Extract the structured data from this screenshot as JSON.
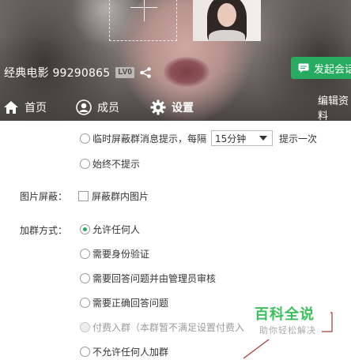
{
  "header": {
    "group_name": "经典电影 99290865",
    "level_badge": "LV0",
    "send_message_button": "发起会话",
    "tabs": [
      {
        "label": "首页",
        "icon": "home-icon"
      },
      {
        "label": "成员",
        "icon": "user-icon"
      },
      {
        "label": "设置",
        "icon": "gear-icon",
        "active": true
      },
      {
        "label": "编辑资料"
      }
    ]
  },
  "settings": {
    "message_notify": {
      "option_periodic_prefix": "临时屏蔽群消息提示，每隔",
      "interval_value": "15分钟",
      "option_periodic_suffix": "提示一次",
      "option_never": "始终不提示"
    },
    "image_block": {
      "label": "图片屏蔽：",
      "checkbox_label": "屏蔽群内图片",
      "checked": false
    },
    "join_method": {
      "label": "加群方式：",
      "options": [
        {
          "label": "允许任何人",
          "selected": true,
          "disabled": false
        },
        {
          "label": "需要身份验证",
          "selected": false,
          "disabled": false
        },
        {
          "label": "需要回答问题并由管理员审核",
          "selected": false,
          "disabled": false
        },
        {
          "label": "需要正确回答问题",
          "selected": false,
          "disabled": false
        },
        {
          "label": "付费入群（本群暂不满足设置付费入",
          "selected": false,
          "disabled": true
        },
        {
          "label": "不允许任何人加群",
          "selected": false,
          "disabled": false
        }
      ]
    }
  },
  "watermark": {
    "title": "百科全说",
    "subtitle": "助你轻松解决"
  },
  "colors": {
    "accent_green": "#26ab61",
    "radio_checked": "#2aa866",
    "watermark_green": "#3cbf5b"
  }
}
